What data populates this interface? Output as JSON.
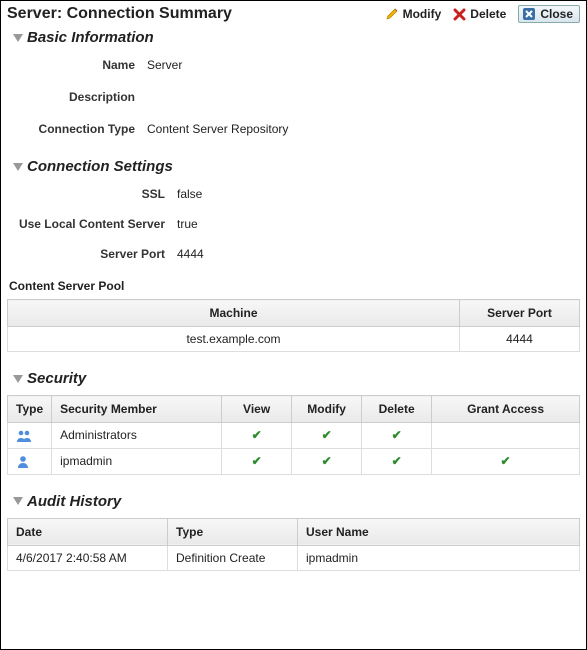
{
  "header": {
    "title": "Server: Connection Summary",
    "modify": "Modify",
    "delete": "Delete",
    "close": "Close"
  },
  "sections": {
    "basic": {
      "title": "Basic Information",
      "name_label": "Name",
      "name_value": "Server",
      "description_label": "Description",
      "description_value": "",
      "ctype_label": "Connection Type",
      "ctype_value": "Content Server Repository"
    },
    "conn": {
      "title": "Connection Settings",
      "ssl_label": "SSL",
      "ssl_value": "false",
      "local_label": "Use Local Content Server",
      "local_value": "true",
      "port_label": "Server Port",
      "port_value": "4444"
    },
    "pool": {
      "label": "Content Server Pool",
      "col_machine": "Machine",
      "col_port": "Server Port",
      "rows": [
        {
          "machine": "test.example.com",
          "port": "4444"
        }
      ]
    },
    "security": {
      "title": "Security",
      "col_type": "Type",
      "col_member": "Security Member",
      "col_view": "View",
      "col_modify": "Modify",
      "col_delete": "Delete",
      "col_grant": "Grant Access",
      "rows": [
        {
          "kind": "group",
          "member": "Administrators",
          "view": true,
          "modify": true,
          "delete": true,
          "grant": false
        },
        {
          "kind": "user",
          "member": "ipmadmin",
          "view": true,
          "modify": true,
          "delete": true,
          "grant": true
        }
      ]
    },
    "audit": {
      "title": "Audit History",
      "col_date": "Date",
      "col_type": "Type",
      "col_user": "User Name",
      "rows": [
        {
          "date": "4/6/2017 2:40:58 AM",
          "type": "Definition Create",
          "user": "ipmadmin"
        }
      ]
    }
  }
}
